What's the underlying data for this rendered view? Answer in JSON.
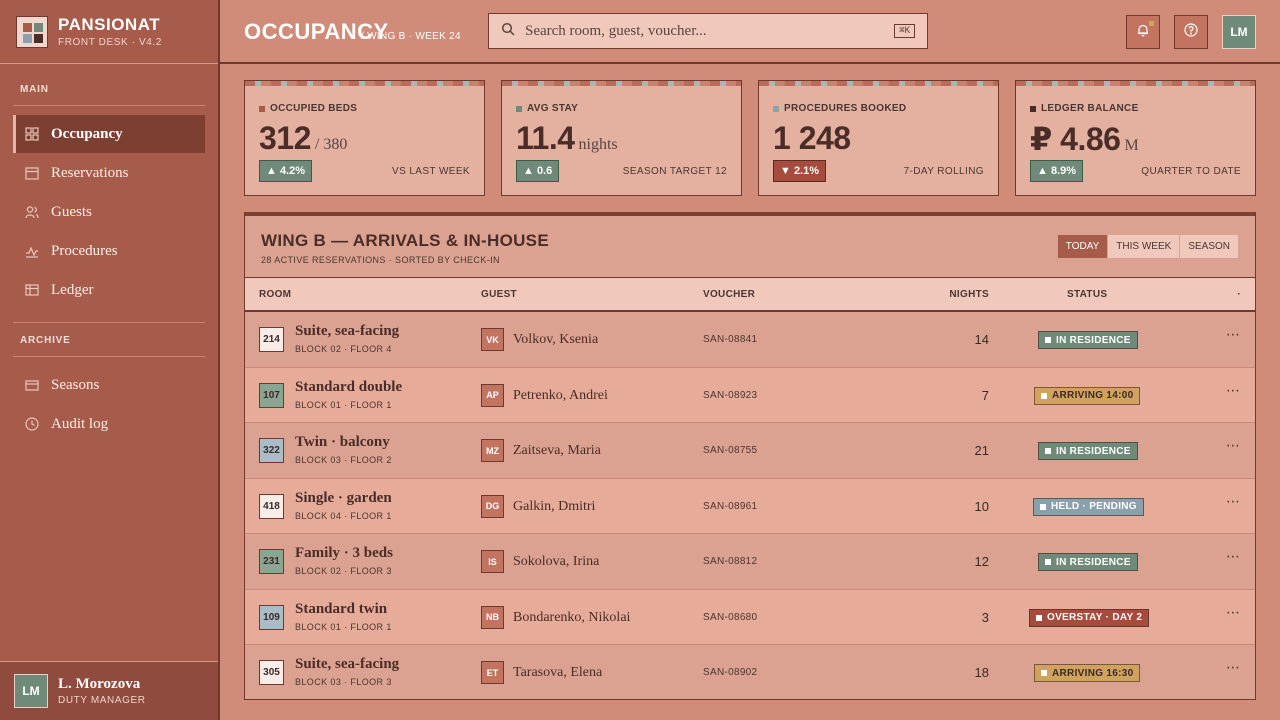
{
  "brand": {
    "name": "PANSIONAT",
    "sub": "FRONT DESK · V4.2"
  },
  "sidebar": {
    "main_label": "MAIN",
    "archive_label": "ARCHIVE",
    "items": [
      {
        "label": "Occupancy",
        "icon": "grid-icon"
      },
      {
        "label": "Reservations",
        "icon": "calendar-icon"
      },
      {
        "label": "Guests",
        "icon": "users-icon"
      },
      {
        "label": "Procedures",
        "icon": "pulse-icon"
      },
      {
        "label": "Ledger",
        "icon": "table-icon"
      }
    ],
    "archive_items": [
      {
        "label": "Seasons",
        "icon": "card-icon"
      },
      {
        "label": "Audit log",
        "icon": "clock-icon"
      }
    ],
    "active": "Occupancy"
  },
  "user": {
    "initials": "LM",
    "name": "L. Morozova",
    "role": "DUTY MANAGER"
  },
  "header": {
    "title": "OCCUPANCY",
    "crumb": "/ WING B · WEEK 24",
    "search_placeholder": "Search room, guest, voucher...",
    "shortcut": "⌘K",
    "avatar": "LM"
  },
  "kpis": [
    {
      "label": "OCCUPIED BEDS",
      "value": "312",
      "unit": "/ 380",
      "delta": "▲ 4.2%",
      "dir": "up",
      "note": "VS LAST WEEK",
      "swatch": "#a75c4b"
    },
    {
      "label": "AVG STAY",
      "value": "11.4",
      "unit": "nights",
      "delta": "▲ 0.6",
      "dir": "up",
      "note": "SEASON TARGET 12",
      "swatch": "#6f8a79"
    },
    {
      "label": "PROCEDURES BOOKED",
      "value": "1 248",
      "unit": "",
      "delta": "▼ 2.1%",
      "dir": "down",
      "note": "7-DAY ROLLING",
      "swatch": "#8aa0ac"
    },
    {
      "label": "LEDGER BALANCE",
      "value": "₽ 4.86",
      "unit": "M",
      "delta": "▲ 8.9%",
      "dir": "up",
      "note": "QUARTER TO DATE",
      "swatch": "#4a2d27"
    }
  ],
  "panel": {
    "title": "WING B — ARRIVALS & IN-HOUSE",
    "sub": "28 ACTIVE RESERVATIONS · SORTED BY CHECK-IN",
    "tabs": [
      "TODAY",
      "THIS WEEK",
      "SEASON"
    ],
    "columns": {
      "room": "ROOM",
      "guest": "GUEST",
      "voucher": "VOUCHER",
      "nights": "NIGHTS",
      "status": "STATUS",
      "more": "·"
    }
  },
  "rows": [
    {
      "code": "214",
      "codebg": "#f7ece7",
      "room": "Suite, sea-facing",
      "loc": "BLOCK 02 · FLOOR 4",
      "initials": "VK",
      "guest": "Volkov, Ksenia",
      "voucher": "SAN-08841",
      "nights": "14",
      "status": "IN RESIDENCE",
      "statusbg": "#6f8a79",
      "statuscolor": "#fff"
    },
    {
      "code": "107",
      "codebg": "#8aa592",
      "room": "Standard double",
      "loc": "BLOCK 01 · FLOOR 1",
      "initials": "AP",
      "guest": "Petrenko, Andrei",
      "voucher": "SAN-08923",
      "nights": "7",
      "status": "ARRIVING 14:00",
      "statusbg": "#d1a25d",
      "statuscolor": "#3a2a27"
    },
    {
      "code": "322",
      "codebg": "#a9bcc8",
      "room": "Twin · balcony",
      "loc": "BLOCK 03 · FLOOR 2",
      "initials": "MZ",
      "guest": "Zaitseva, Maria",
      "voucher": "SAN-08755",
      "nights": "21",
      "status": "IN RESIDENCE",
      "statusbg": "#6f8a79",
      "statuscolor": "#fff"
    },
    {
      "code": "418",
      "codebg": "#f7ece7",
      "room": "Single · garden",
      "loc": "BLOCK 04 · FLOOR 1",
      "initials": "DG",
      "guest": "Galkin, Dmitri",
      "voucher": "SAN-08961",
      "nights": "10",
      "status": "HELD · PENDING",
      "statusbg": "#8aa0ac",
      "statuscolor": "#fff"
    },
    {
      "code": "231",
      "codebg": "#8aa592",
      "room": "Family · 3 beds",
      "loc": "BLOCK 02 · FLOOR 3",
      "initials": "IS",
      "guest": "Sokolova, Irina",
      "voucher": "SAN-08812",
      "nights": "12",
      "status": "IN RESIDENCE",
      "statusbg": "#6f8a79",
      "statuscolor": "#fff"
    },
    {
      "code": "109",
      "codebg": "#a9bcc8",
      "room": "Standard twin",
      "loc": "BLOCK 01 · FLOOR 1",
      "initials": "NB",
      "guest": "Bondarenko, Nikolai",
      "voucher": "SAN-08680",
      "nights": "3",
      "status": "OVERSTAY · DAY 2",
      "statusbg": "#a54c3c",
      "statuscolor": "#fff"
    },
    {
      "code": "305",
      "codebg": "#f7ece7",
      "room": "Suite, sea-facing",
      "loc": "BLOCK 03 · FLOOR 3",
      "initials": "ET",
      "guest": "Tarasova, Elena",
      "voucher": "SAN-08902",
      "nights": "18",
      "status": "ARRIVING 16:30",
      "statusbg": "#d1a25d",
      "statuscolor": "#3a2a27"
    }
  ]
}
